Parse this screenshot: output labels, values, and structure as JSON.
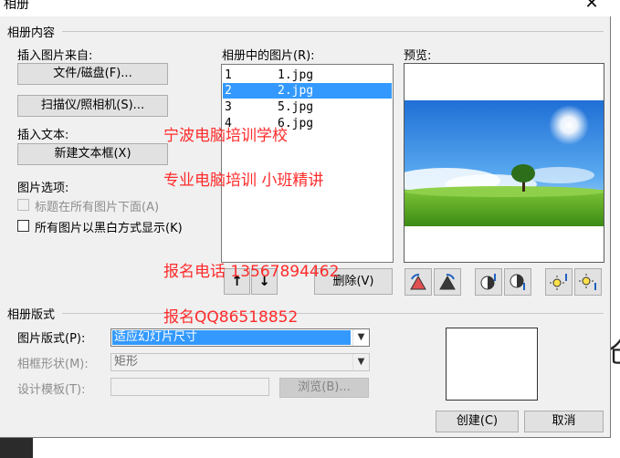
{
  "window": {
    "title": "相册",
    "close_symbol": "✕"
  },
  "album_content": {
    "group_label": "相册内容",
    "insert_from_label": "插入图片来自:",
    "file_disk_button": "文件/磁盘(F)...",
    "scanner_button": "扫描仪/照相机(S)...",
    "insert_text_label": "插入文本:",
    "new_textbox_button": "新建文本框(X)",
    "picture_options_label": "图片选项:",
    "caption_below_option": "标题在所有图片下面(A)",
    "black_white_option": "所有图片以黑白方式显示(K)"
  },
  "pictures_list": {
    "label": "相册中的图片(R):",
    "items": [
      {
        "num": "1",
        "name": "1.jpg",
        "selected": false
      },
      {
        "num": "2",
        "name": "2.jpg",
        "selected": true
      },
      {
        "num": "3",
        "name": "5.jpg",
        "selected": false
      },
      {
        "num": "4",
        "name": "6.jpg",
        "selected": false
      }
    ],
    "move_up_symbol": "↑",
    "move_down_symbol": "↓",
    "delete_button": "删除(V)"
  },
  "preview": {
    "label": "预览:",
    "image_icon": "sky-meadow-tree-image",
    "tool_icons": [
      "rotate-left-icon",
      "rotate-right-icon",
      "contrast-up-icon",
      "contrast-down-icon",
      "brightness-up-icon",
      "brightness-down-icon"
    ]
  },
  "album_layout": {
    "group_label": "相册版式",
    "picture_layout_label": "图片版式(P):",
    "picture_layout_value": "适应幻灯片尺寸",
    "frame_shape_label": "相框形状(M):",
    "frame_shape_value": "矩形",
    "design_template_label": "设计模板(T):",
    "design_template_value": "",
    "browse_button": "浏览(B)..."
  },
  "actions": {
    "create_button": "创建(C)",
    "cancel_button": "取消"
  },
  "watermark": {
    "line1": "宁波电脑培训学校",
    "line2": "专业电脑培训 小班精讲",
    "line3": "报名电话 13567894462",
    "line4": "报名QQ86518852"
  },
  "background": {
    "partial_char": "仓"
  },
  "colors": {
    "dialog_bg": "#f0f0f0",
    "selection": "#3399ff",
    "watermark": "#ff2b2b"
  }
}
